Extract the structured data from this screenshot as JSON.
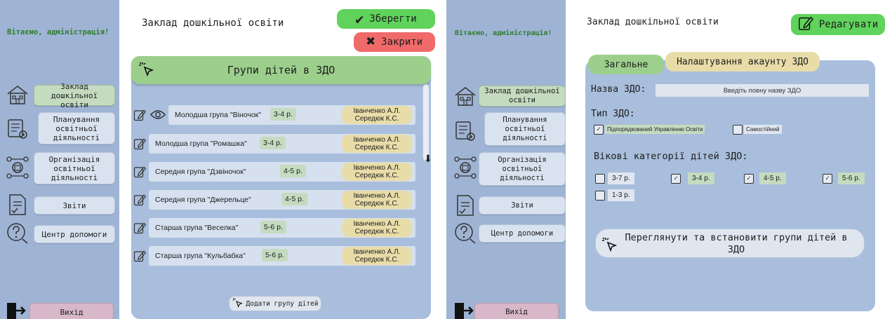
{
  "left": {
    "welcome": "Вітаємо, адміністрація!",
    "nav": {
      "institution": "Заклад дошкільної освіти",
      "planning": "Планування освітньої діяльності",
      "organization": "Організація освітньої діяльності",
      "reports": "Звіти",
      "help": "Центр допомоги",
      "exit": "Вихід"
    },
    "page_title": "Заклад дошкільної освіти",
    "save_label": "Зберегти",
    "close_label": "Закрити",
    "panel_title": "Групи дітей в ЗДО",
    "groups": [
      {
        "name": "Молодша група \"Віночок\"",
        "age": "3-4 р.",
        "teacher1": "Іванченко А.Л.",
        "teacher2": "Середюк К.С."
      },
      {
        "name": "Молодша група \"Ромашка\"",
        "age": "3-4 р.",
        "teacher1": "Іванченко А.Л.",
        "teacher2": "Середюк К.С."
      },
      {
        "name": "Середня група \"Дзвіночок\"",
        "age": "4-5 р.",
        "teacher1": "Іванченко А.Л.",
        "teacher2": "Середюк К.С."
      },
      {
        "name": "Середня група \"Джерельце\"",
        "age": "4-5 р.",
        "teacher1": "Іванченко А.Л.",
        "teacher2": "Середюк К.С."
      },
      {
        "name": "Старша група \"Веселка\"",
        "age": "5-6 р.",
        "teacher1": "Іванченко А.Л.",
        "teacher2": "Середюк К.С."
      },
      {
        "name": "Старша група \"Кульбабка\"",
        "age": "5-6 р.",
        "teacher1": "Іванченко А.Л.",
        "teacher2": "Середюк К.С."
      }
    ],
    "add_group_label": "Додати групу дітей"
  },
  "right": {
    "welcome": "Вітаємо, адміністрація!",
    "nav": {
      "institution": "Заклад дошкільної освіти",
      "planning": "Планування освітньої діяльності",
      "organization": "Організація освітньої діяльності",
      "reports": "Звіти",
      "help": "Центр допомоги",
      "exit": "Вихід"
    },
    "page_title": "Заклад дошкільної освіти",
    "edit_label": "Редагувати",
    "tabs": {
      "general": "Загальне",
      "account": "Налаштування акаунту ЗДО"
    },
    "name_label": "Назва ЗДО:",
    "name_placeholder": "Введіть повну назву ЗДО",
    "type_label": "Тип ЗДО:",
    "type_options": [
      {
        "label": "Підпорядкований Управлінню Освіти",
        "checked": true
      },
      {
        "label": "Самостійний",
        "checked": false
      }
    ],
    "age_label": "Вікові категорії дітей ЗДО:",
    "age_options": [
      {
        "label": "3-7 р.",
        "checked": false
      },
      {
        "label": "3-4 р.",
        "checked": true
      },
      {
        "label": "4-5 р.",
        "checked": true
      },
      {
        "label": "5-6 р.",
        "checked": true
      },
      {
        "label": "1-3 р.",
        "checked": false
      }
    ],
    "view_groups_label": "Переглянути та встановити групи дітей в ЗДО"
  },
  "colors": {
    "sidebar": "#9fb4d4",
    "green": "#5fd35b",
    "red": "#f06a6a",
    "panel": "#a8bedc",
    "panel_head": "#9ccf8c",
    "age_badge": "#c5dbc0",
    "teacher_badge": "#e8dca8",
    "exit": "#d8b8c8"
  }
}
